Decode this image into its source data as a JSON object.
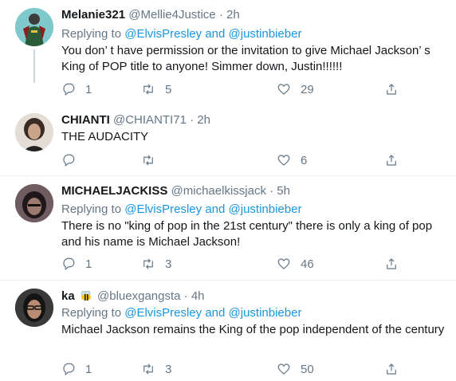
{
  "tweets": [
    {
      "name": "Melanie321",
      "handle": "@Mellie4Justice",
      "time": "2h",
      "replying_label": "Replying to",
      "replying_user1": "@ElvisPresley",
      "replying_and": "and",
      "replying_user2": "@justinbieber",
      "text": "You don’   t have permission or the invitation to give Michael Jackson’   s King of POP title to anyone! Simmer down, Justin!!!!!!",
      "replies": "1",
      "retweets": "5",
      "likes": "29"
    },
    {
      "name": "CHIANTI",
      "handle": "@CHIANTI71",
      "time": "2h",
      "text": "THE AUDACITY",
      "replies": "",
      "retweets": "",
      "likes": "6"
    },
    {
      "name": "MICHAELJACKISS",
      "handle": "@michaelkissjack",
      "time": "5h",
      "replying_label": "Replying to",
      "replying_user1": "@ElvisPresley",
      "replying_and": "and",
      "replying_user2": "@justinbieber",
      "text": "There is no \"king of pop in the 21st century\" there is only a king of pop and his name is Michael Jackson!",
      "replies": "1",
      "retweets": "3",
      "likes": "46"
    },
    {
      "name": "ka",
      "handle": "@bluexgangsta",
      "time": "4h",
      "replying_label": "Replying to",
      "replying_user1": "@ElvisPresley",
      "replying_and": "and",
      "replying_user2": "@justinbieber",
      "text": "Michael Jackson remains the King of the pop independent of the century",
      "replies": "1",
      "retweets": "3",
      "likes": "50"
    }
  ],
  "separator": "·",
  "colors": {
    "link": "#1b95e0",
    "muted": "#657786",
    "divider": "#e6ecf0"
  }
}
